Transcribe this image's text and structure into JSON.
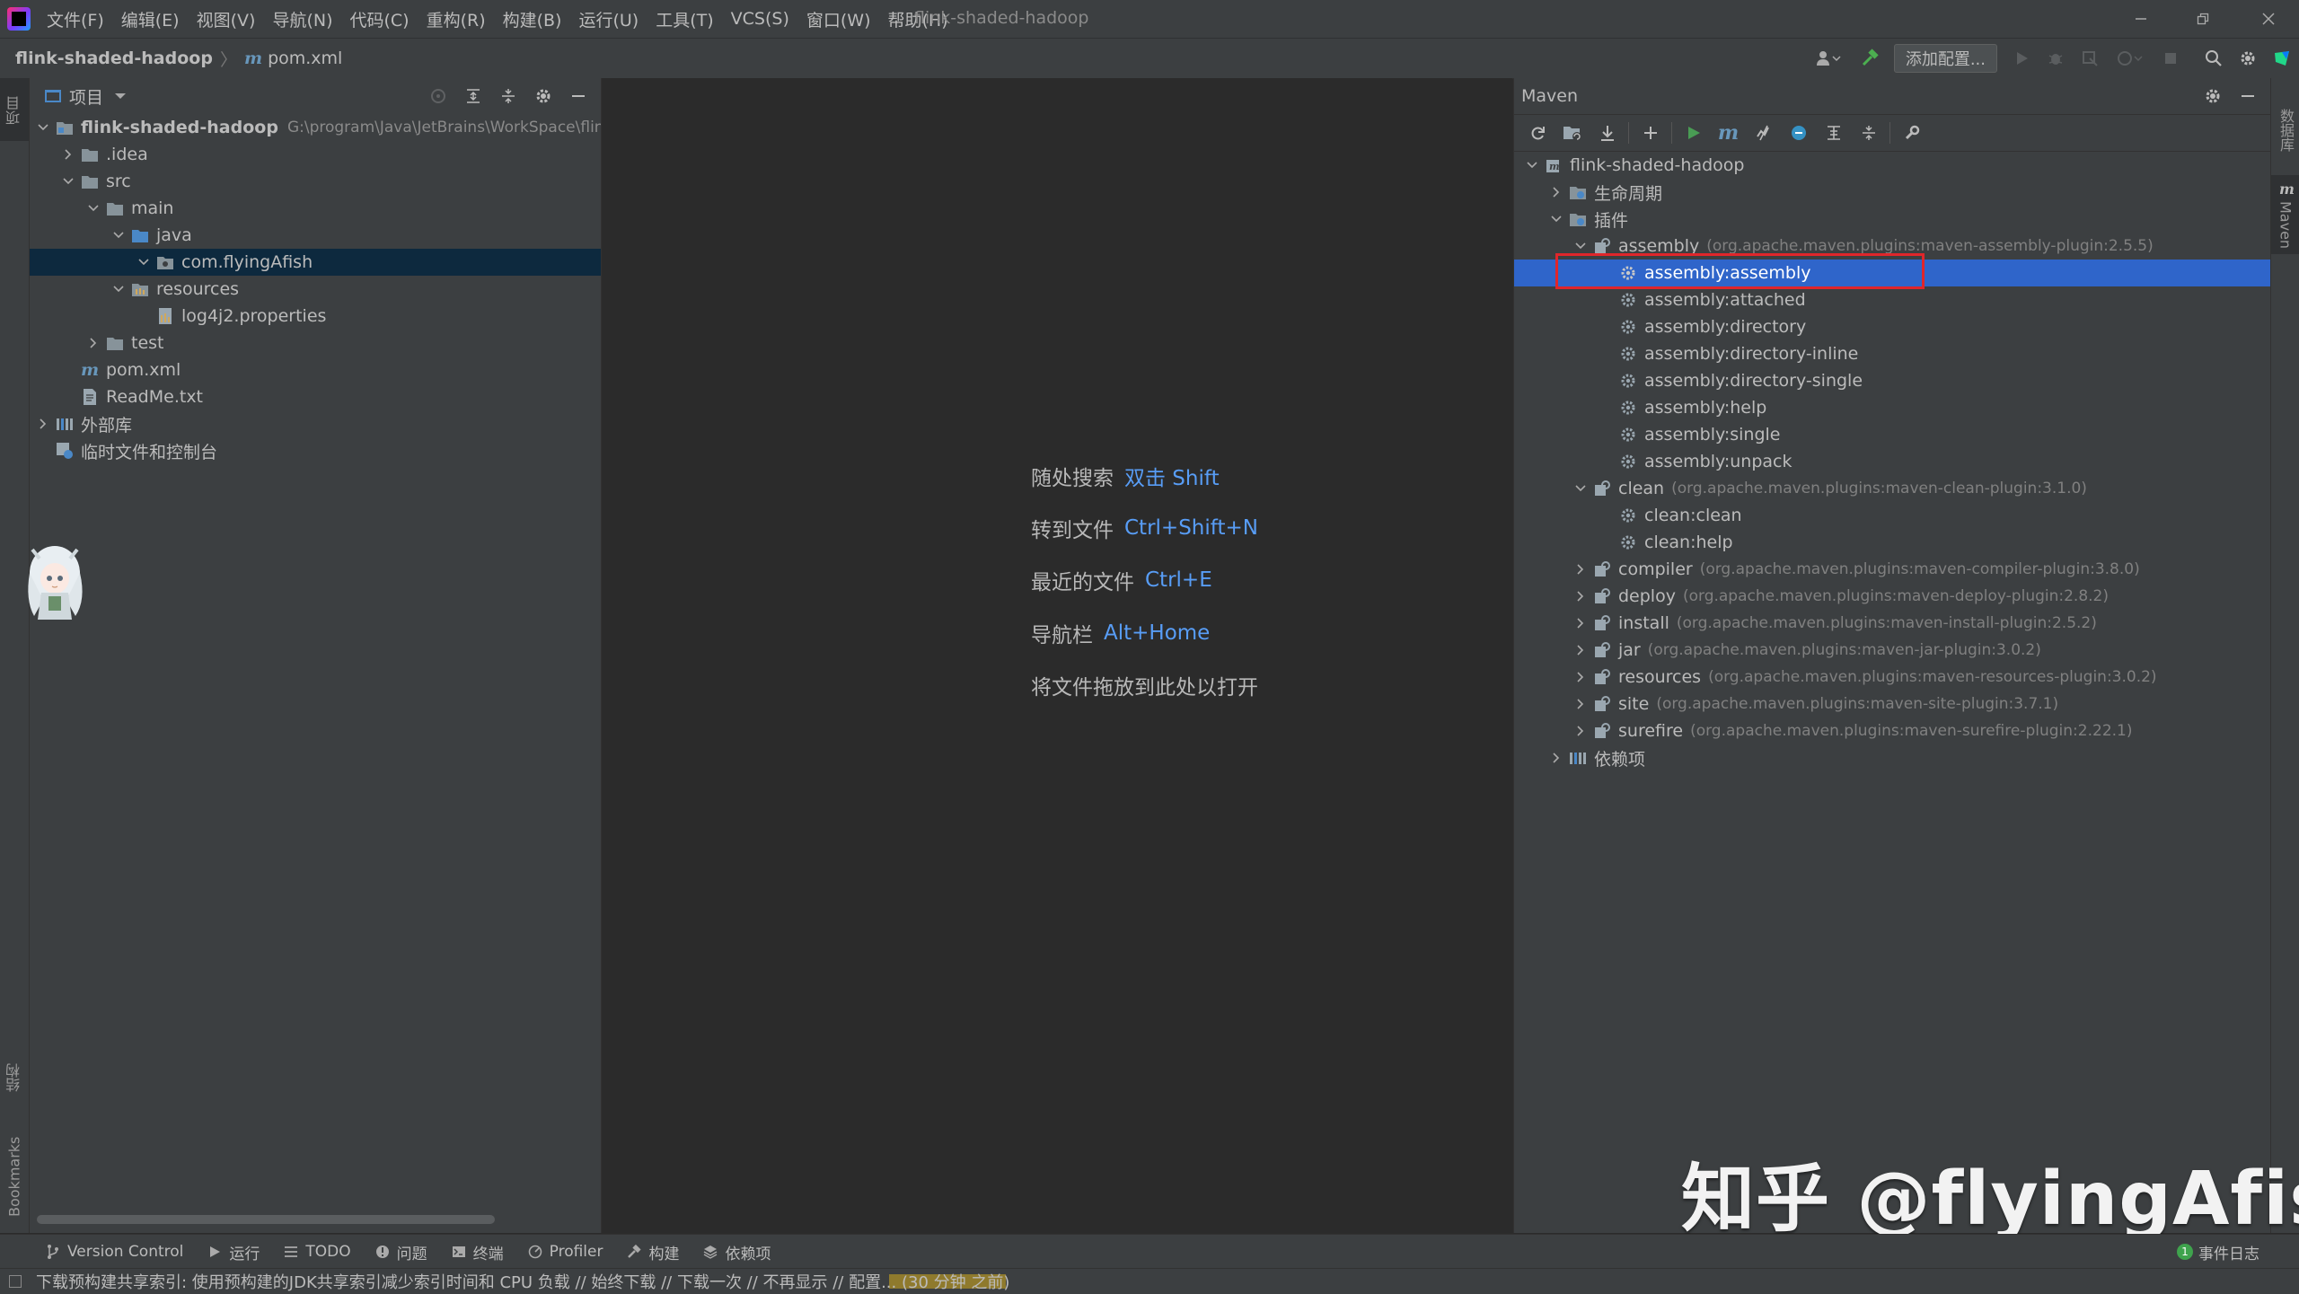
{
  "menubar": {
    "items": [
      "文件(F)",
      "编辑(E)",
      "视图(V)",
      "导航(N)",
      "代码(C)",
      "重构(R)",
      "构建(B)",
      "运行(U)",
      "工具(T)",
      "VCS(S)",
      "窗口(W)",
      "帮助(H)"
    ],
    "window_title": "flink-shaded-hadoop"
  },
  "navbar": {
    "project": "flink-shaded-hadoop",
    "file_icon_letter": "m",
    "file": "pom.xml",
    "add_config_label": "添加配置..."
  },
  "left_stripe": {
    "project_tab": "项目",
    "structure_tab": "结构",
    "bookmarks_tab": "Bookmarks"
  },
  "right_stripe": {
    "database_tab": "数据库",
    "maven_tab": "Maven",
    "maven_letter": "m"
  },
  "project_panel": {
    "title": "项目",
    "tree": [
      {
        "label": "flink-shaded-hadoop",
        "path": "G:\\program\\Java\\JetBrains\\WorkSpace\\flink"
      },
      {
        "label": ".idea"
      },
      {
        "label": "src"
      },
      {
        "label": "main"
      },
      {
        "label": "java"
      },
      {
        "label": "com.flyingAfish"
      },
      {
        "label": "resources"
      },
      {
        "label": "log4j2.properties"
      },
      {
        "label": "test"
      },
      {
        "label": "pom.xml",
        "icon_letter": "m"
      },
      {
        "label": "ReadMe.txt"
      },
      {
        "label": "外部库"
      },
      {
        "label": "临时文件和控制台"
      }
    ]
  },
  "editor": {
    "hints": [
      {
        "label": "随处搜索",
        "key": "双击 Shift"
      },
      {
        "label": "转到文件",
        "key": "Ctrl+Shift+N"
      },
      {
        "label": "最近的文件",
        "key": "Ctrl+E"
      },
      {
        "label": "导航栏",
        "key": "Alt+Home"
      },
      {
        "label": "将文件拖放到此处以打开",
        "key": ""
      }
    ]
  },
  "maven": {
    "title": "Maven",
    "toolbar_letter": "m",
    "root": "flink-shaded-hadoop",
    "lifecycle": "生命周期",
    "plugins": "插件",
    "dependencies": "依赖项",
    "assembly": {
      "name": "assembly",
      "gav": "(org.apache.maven.plugins:maven-assembly-plugin:2.5.5)"
    },
    "assembly_goals": [
      "assembly:assembly",
      "assembly:attached",
      "assembly:directory",
      "assembly:directory-inline",
      "assembly:directory-single",
      "assembly:help",
      "assembly:single",
      "assembly:unpack"
    ],
    "clean": {
      "name": "clean",
      "gav": "(org.apache.maven.plugins:maven-clean-plugin:3.1.0)"
    },
    "clean_goals": [
      "clean:clean",
      "clean:help"
    ],
    "collapsed_plugins": [
      {
        "name": "compiler",
        "gav": "(org.apache.maven.plugins:maven-compiler-plugin:3.8.0)"
      },
      {
        "name": "deploy",
        "gav": "(org.apache.maven.plugins:maven-deploy-plugin:2.8.2)"
      },
      {
        "name": "install",
        "gav": "(org.apache.maven.plugins:maven-install-plugin:2.5.2)"
      },
      {
        "name": "jar",
        "gav": "(org.apache.maven.plugins:maven-jar-plugin:3.0.2)"
      },
      {
        "name": "resources",
        "gav": "(org.apache.maven.plugins:maven-resources-plugin:3.0.2)"
      },
      {
        "name": "site",
        "gav": "(org.apache.maven.plugins:maven-site-plugin:3.7.1)"
      },
      {
        "name": "surefire",
        "gav": "(org.apache.maven.plugins:maven-surefire-plugin:2.22.1)"
      }
    ],
    "selected_goal": "assembly:assembly"
  },
  "watermark": "知乎 @flyingAfish",
  "bottom_tabs": [
    "Version Control",
    "运行",
    "TODO",
    "问题",
    "终端",
    "Profiler",
    "构建",
    "依赖项"
  ],
  "event_log": {
    "count": "1",
    "label": "事件日志"
  },
  "status": "下载预构建共享索引: 使用预构建的JDK共享索引减少索引时间和 CPU 负载 // 始终下载 // 下载一次 // 不再显示 // 配置... (30 分钟 之前)",
  "colors": {
    "accent": "#2f65ca",
    "highlight_box": "#e0262b",
    "link": "#589df6",
    "panel_bg": "#3c3f41",
    "editor_bg": "#2b2b2b"
  }
}
